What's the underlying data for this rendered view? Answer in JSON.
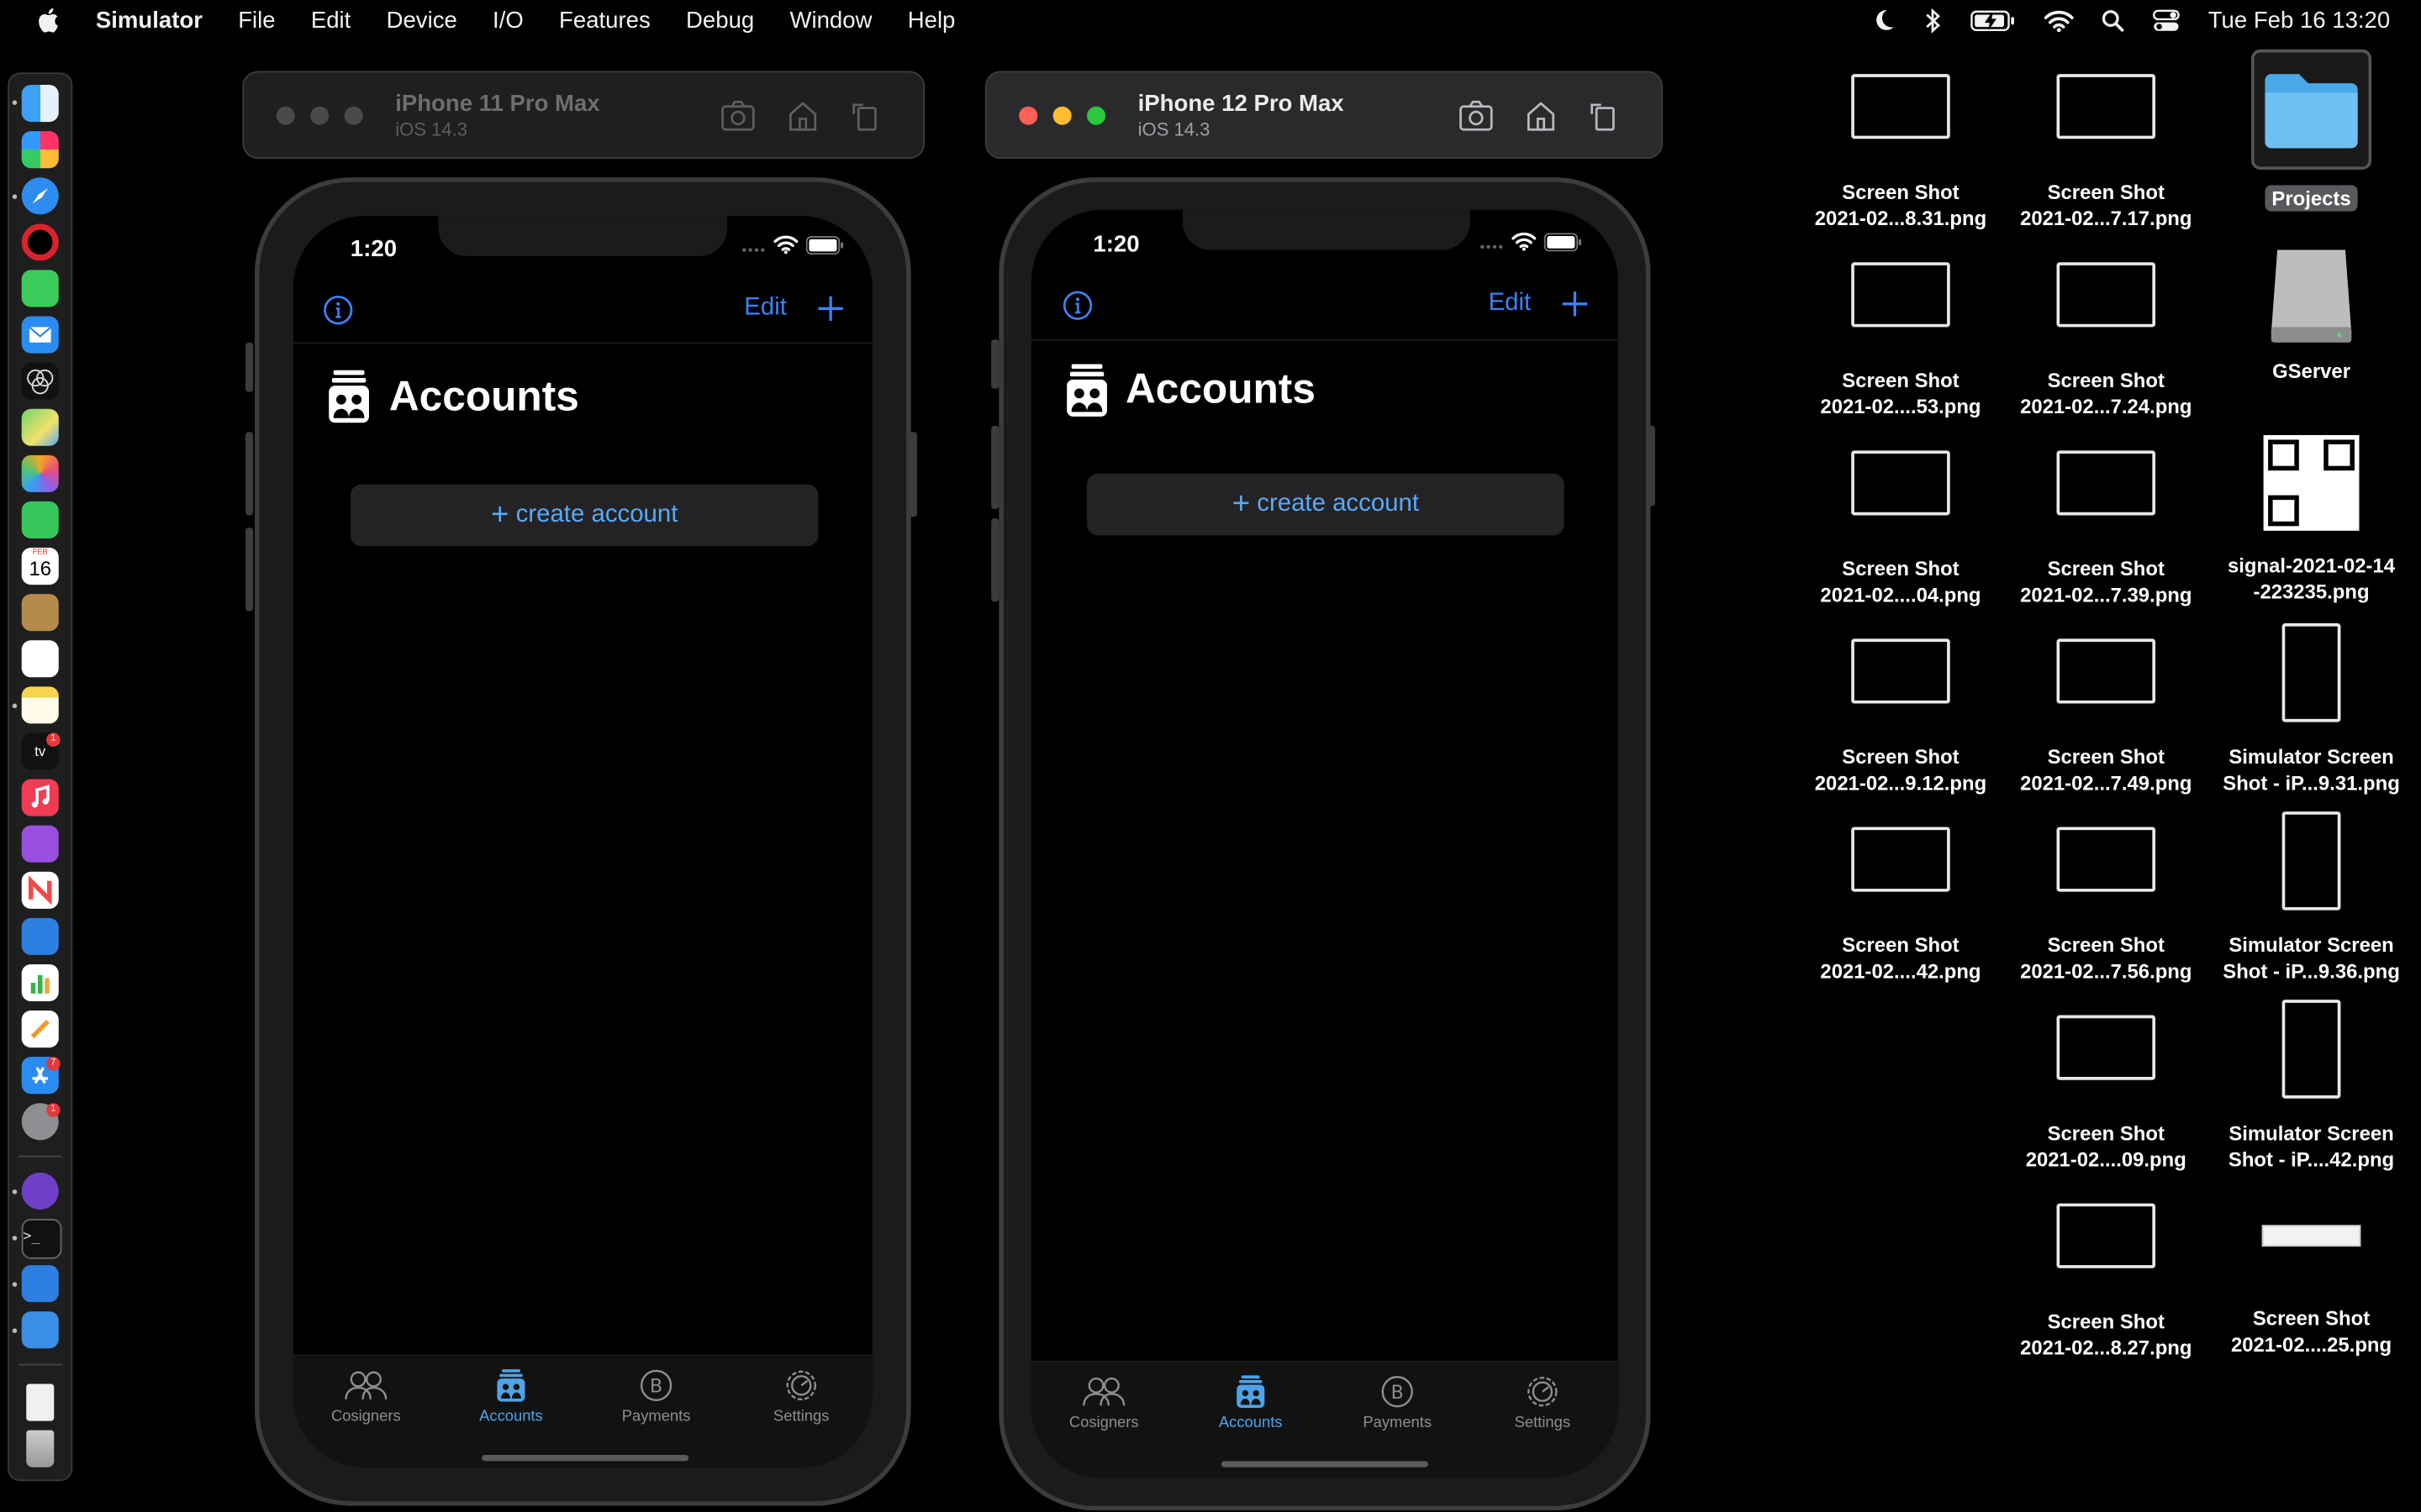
{
  "menubar": {
    "app_name": "Simulator",
    "items": [
      "File",
      "Edit",
      "Device",
      "I/O",
      "Features",
      "Debug",
      "Window",
      "Help"
    ],
    "clock": "Tue Feb 16  13:20",
    "status_icons": [
      "moon-icon",
      "bluetooth-icon",
      "battery-charging-icon",
      "wifi-icon",
      "search-icon",
      "control-center-icon"
    ]
  },
  "dock": {
    "apps": [
      "finder",
      "launchpad",
      "safari",
      "opera",
      "messages",
      "mail",
      "colors",
      "maps",
      "photos",
      "facetime",
      "calendar",
      "contacts",
      "reminders",
      "notes",
      "apple-tv",
      "music",
      "podcasts",
      "news",
      "keynote",
      "numbers",
      "pages",
      "app-store",
      "system-preferences",
      "github",
      "terminal",
      "xcode",
      "instruments",
      "document",
      "trash"
    ],
    "calendar_month": "FEB",
    "calendar_day": "16",
    "tv_badge": "1",
    "appstore_badge": "7",
    "prefs_badge": "1"
  },
  "simulators": [
    {
      "device": "iPhone 11 Pro Max",
      "os": "iOS 14.3",
      "active": false,
      "status_time": "1:20",
      "nav_edit": "Edit",
      "title": "Accounts",
      "create_label": "create account",
      "tabs": [
        "Cosigners",
        "Accounts",
        "Payments",
        "Settings"
      ],
      "selected_tab": "Accounts"
    },
    {
      "device": "iPhone 12 Pro Max",
      "os": "iOS 14.3",
      "active": true,
      "status_time": "1:20",
      "nav_edit": "Edit",
      "title": "Accounts",
      "create_label": "create account",
      "tabs": [
        "Cosigners",
        "Accounts",
        "Payments",
        "Settings"
      ],
      "selected_tab": "Accounts"
    }
  ],
  "desktop": [
    {
      "line1": "Screen Shot",
      "line2": "2021-02...8.31.png"
    },
    {
      "line1": "Screen Shot",
      "line2": "2021-02...7.17.png"
    },
    {
      "line1": "Projects",
      "line2": ""
    },
    {
      "line1": "Screen Shot",
      "line2": "2021-02....53.png"
    },
    {
      "line1": "Screen Shot",
      "line2": "2021-02...7.24.png"
    },
    {
      "line1": "GServer",
      "line2": ""
    },
    {
      "line1": "Screen Shot",
      "line2": "2021-02....04.png"
    },
    {
      "line1": "Screen Shot",
      "line2": "2021-02...7.39.png"
    },
    {
      "line1": "signal-2021-02-14",
      "line2": "-223235.png"
    },
    {
      "line1": "Screen Shot",
      "line2": "2021-02...9.12.png"
    },
    {
      "line1": "Screen Shot",
      "line2": "2021-02...7.49.png"
    },
    {
      "line1": "Simulator Screen",
      "line2": "Shot - iP...9.31.png"
    },
    {
      "line1": "Screen Shot",
      "line2": "2021-02....42.png"
    },
    {
      "line1": "Screen Shot",
      "line2": "2021-02...7.56.png"
    },
    {
      "line1": "Simulator Screen",
      "line2": "Shot - iP...9.36.png"
    },
    {
      "line1": "Screen Shot",
      "line2": "2021-02....09.png"
    },
    {
      "line1": "Simulator Screen",
      "line2": "Shot - iP....42.png"
    },
    {
      "line1": "Screen Shot",
      "line2": "2021-02...8.27.png"
    },
    {
      "line1": "Screen Shot",
      "line2": "2021-02....25.png"
    }
  ]
}
